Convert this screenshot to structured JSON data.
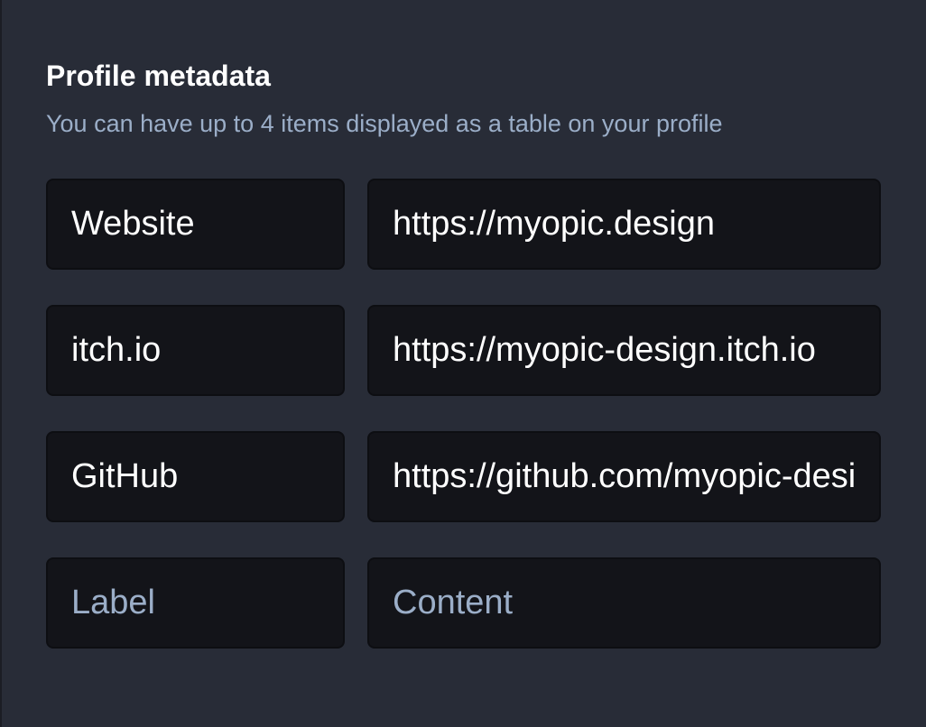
{
  "section": {
    "title": "Profile metadata",
    "hint": "You can have up to 4 items displayed as a table on your profile"
  },
  "fields": [
    {
      "label": "Website",
      "value": "https://myopic.design"
    },
    {
      "label": "itch.io",
      "value": "https://myopic-design.itch.io"
    },
    {
      "label": "GitHub",
      "value": "https://github.com/myopic-design"
    },
    {
      "label": "",
      "value": ""
    }
  ],
  "placeholders": {
    "label": "Label",
    "value": "Content"
  },
  "colors": {
    "panel_background": "#282c37",
    "input_background": "#131419",
    "hint_text": "#9baec8",
    "text": "#ffffff"
  }
}
